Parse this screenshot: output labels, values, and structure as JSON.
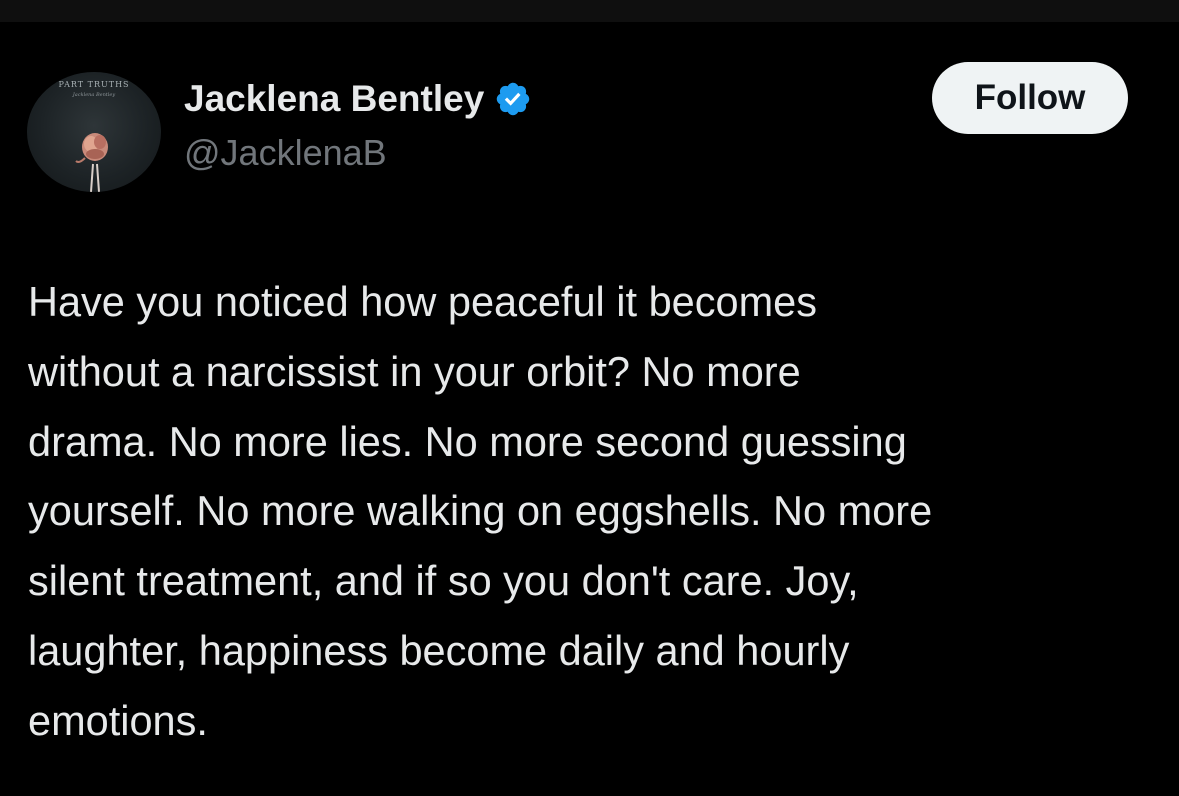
{
  "author": {
    "avatar_title": "PART TRUTHS",
    "avatar_subtitle": "Jacklena Bentley",
    "display_name": "Jacklena Bentley",
    "handle": "@JacklenaB",
    "verified": true,
    "verified_icon": "verified-badge-icon"
  },
  "actions": {
    "follow_label": "Follow"
  },
  "tweet": {
    "text": "Have you noticed how peaceful it becomes\nwithout a narcissist in your orbit? No more\ndrama. No more lies. No more second guessing\nyourself. No more walking on eggshells. No more\nsilent treatment, and if so you don't care. Joy,\nlaughter, happiness become daily and hourly\nemotions."
  },
  "colors": {
    "background": "#000000",
    "primary_text": "#e7e9ea",
    "secondary_text": "#71767b",
    "verified_blue": "#1d9bf0",
    "follow_button_bg": "#eff3f4",
    "follow_button_text": "#0f1419"
  }
}
